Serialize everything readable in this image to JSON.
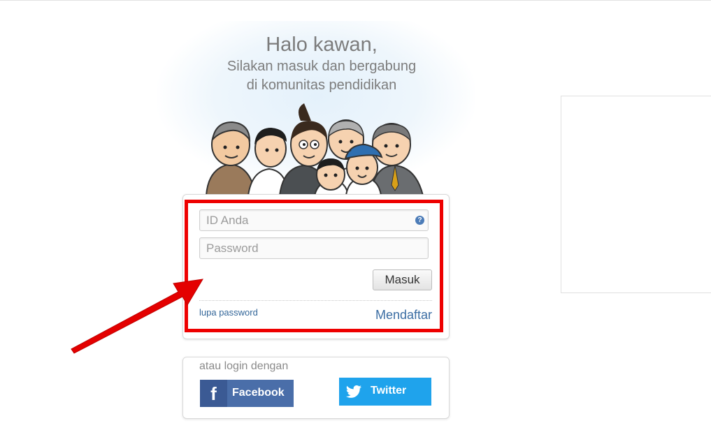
{
  "greeting": {
    "title": "Halo kawan,",
    "line1": "Silakan masuk dan bergabung",
    "line2": "di komunitas pendidikan"
  },
  "login": {
    "id_placeholder": "ID Anda",
    "password_placeholder": "Password",
    "submit_label": "Masuk",
    "forgot_label": "lupa password",
    "register_label": "Mendaftar"
  },
  "social": {
    "prompt": "atau login dengan",
    "facebook_label": "Facebook",
    "facebook_glyph": "f",
    "twitter_label": "Twitter"
  },
  "icons": {
    "help": "help-icon",
    "facebook": "facebook-icon",
    "twitter": "twitter-bird-icon"
  },
  "colors": {
    "highlight": "#ee0000",
    "facebook": "#4a6ea9",
    "twitter": "#1fa3ec",
    "link": "#3b6da3"
  }
}
